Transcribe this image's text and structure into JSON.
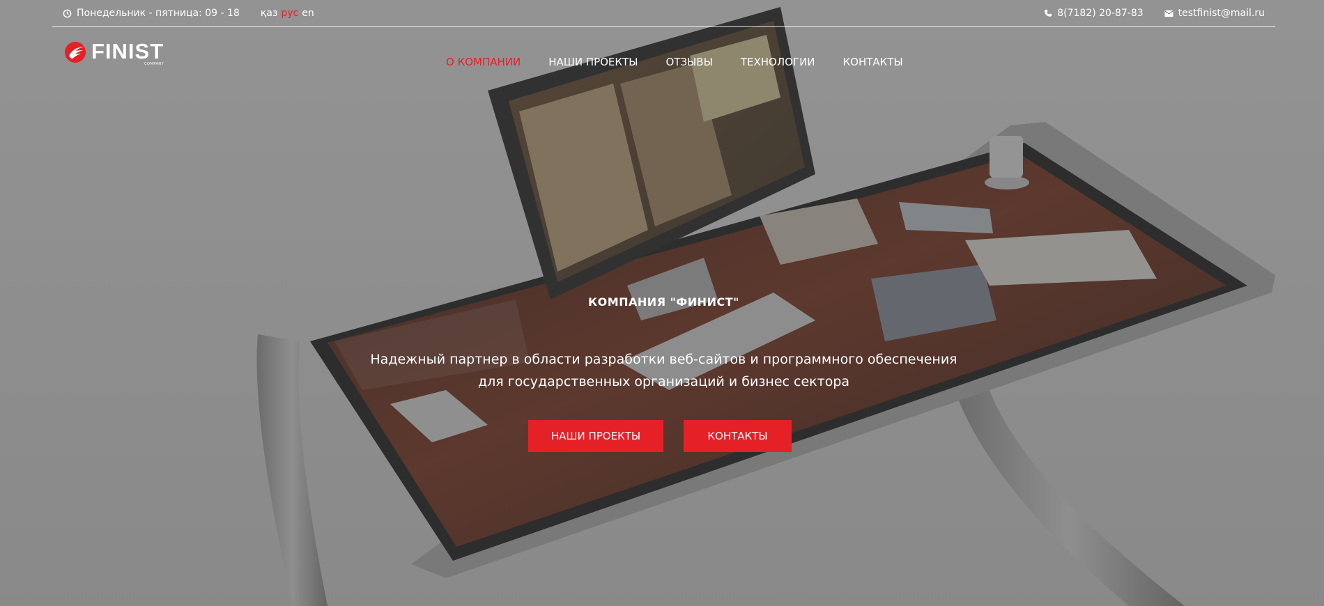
{
  "topbar": {
    "hours": "Понедельник - пятница: 09 - 18",
    "hours_icon": "clock-icon",
    "languages": [
      {
        "label": "қаз",
        "active": false
      },
      {
        "label": "рус",
        "active": true
      },
      {
        "label": "en",
        "active": false
      }
    ],
    "phone": "8(7182) 20-87-83",
    "phone_icon": "phone-icon",
    "email": "testfinist@mail.ru",
    "email_icon": "envelope-icon"
  },
  "logo": {
    "word": "FINIST",
    "sub": "COMPANY"
  },
  "nav": [
    {
      "label": "О КОМПАНИИ",
      "active": true
    },
    {
      "label": "НАШИ ПРОЕКТЫ",
      "active": false
    },
    {
      "label": "ОТЗЫВЫ",
      "active": false
    },
    {
      "label": "ТЕХНОЛОГИИ",
      "active": false
    },
    {
      "label": "КОНТАКТЫ",
      "active": false
    }
  ],
  "hero": {
    "title": "КОМПАНИЯ \"ФИНИСТ\"",
    "subtitle": "Надежный партнер в области разработки веб-сайтов и программного обеспечения для государственных организаций и бизнес сектора",
    "buttons": {
      "projects": "НАШИ ПРОЕКТЫ",
      "contacts": "КОНТАКТЫ"
    }
  },
  "colors": {
    "accent": "#e52027",
    "text": "#ffffff"
  }
}
